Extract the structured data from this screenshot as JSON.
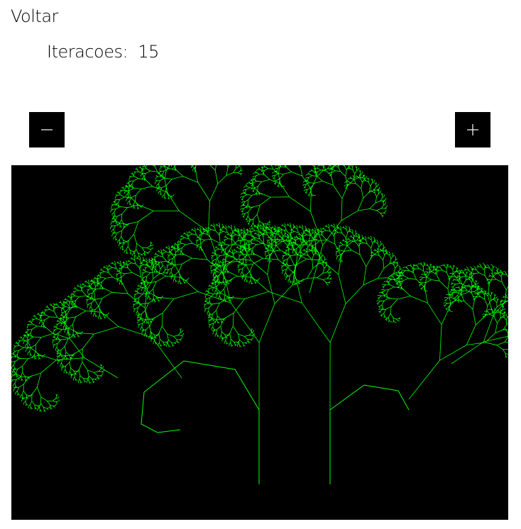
{
  "nav": {
    "back_label": "Voltar"
  },
  "iterations": {
    "label": "Iteracoes:",
    "value": "15"
  },
  "controls": {
    "decrement_icon": "minus-icon",
    "increment_icon": "plus-icon"
  },
  "canvas": {
    "background": "#000000",
    "stroke_color": "#00ff00",
    "icon": "fractal-tree"
  }
}
